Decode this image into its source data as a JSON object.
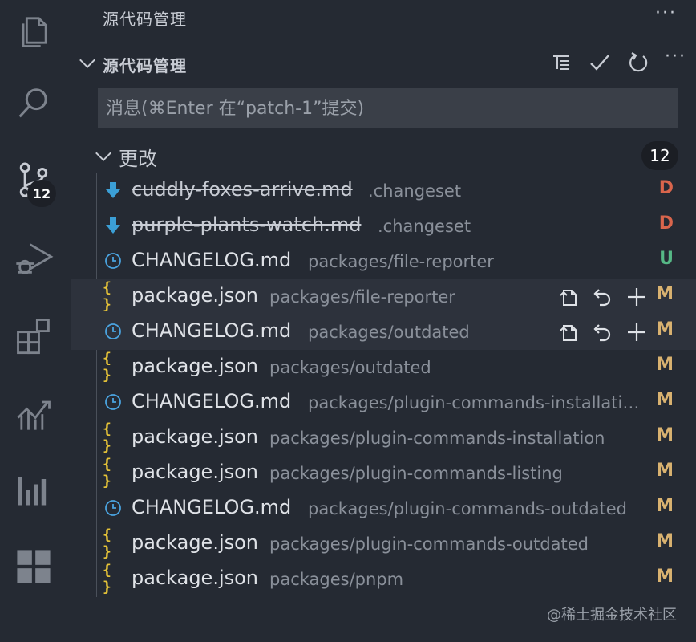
{
  "view_title": "源代码管理",
  "section": {
    "title": "源代码管理"
  },
  "commit": {
    "placeholder": "消息(⌘Enter 在“patch-1”提交)"
  },
  "activity": {
    "scm_badge": "12"
  },
  "changes": {
    "label": "更改",
    "count": "12",
    "files": [
      {
        "name": "cuddly-foxes-arrive.md",
        "path": ".changeset",
        "status": "D",
        "icon": "arrow-down-icon"
      },
      {
        "name": "purple-plants-watch.md",
        "path": ".changeset",
        "status": "D",
        "icon": "arrow-down-icon"
      },
      {
        "name": "CHANGELOG.md",
        "path": "packages/file-reporter",
        "status": "U",
        "icon": "clock-icon"
      },
      {
        "name": "package.json",
        "path": "packages/file-reporter",
        "status": "M",
        "icon": "json-braces-icon"
      },
      {
        "name": "CHANGELOG.md",
        "path": "packages/outdated",
        "status": "M",
        "icon": "clock-icon"
      },
      {
        "name": "package.json",
        "path": "packages/outdated",
        "status": "M",
        "icon": "json-braces-icon"
      },
      {
        "name": "CHANGELOG.md",
        "path": "packages/plugin-commands-installation",
        "status": "M",
        "icon": "clock-icon"
      },
      {
        "name": "package.json",
        "path": "packages/plugin-commands-installation",
        "status": "M",
        "icon": "json-braces-icon"
      },
      {
        "name": "package.json",
        "path": "packages/plugin-commands-listing",
        "status": "M",
        "icon": "json-braces-icon"
      },
      {
        "name": "CHANGELOG.md",
        "path": "packages/plugin-commands-outdated",
        "status": "M",
        "icon": "clock-icon"
      },
      {
        "name": "package.json",
        "path": "packages/plugin-commands-outdated",
        "status": "M",
        "icon": "json-braces-icon"
      },
      {
        "name": "package.json",
        "path": "packages/pnpm",
        "status": "M",
        "icon": "json-braces-icon"
      }
    ]
  },
  "watermark": "@稀土掘金技术社区",
  "colors": {
    "background": "#252a33",
    "status_deleted": "#d9654c",
    "status_untracked": "#56b886",
    "status_modified": "#d9b270",
    "json_icon": "#e5c338",
    "changelog_icon": "#4aa3df",
    "deleted_icon": "#3b9fd6"
  }
}
